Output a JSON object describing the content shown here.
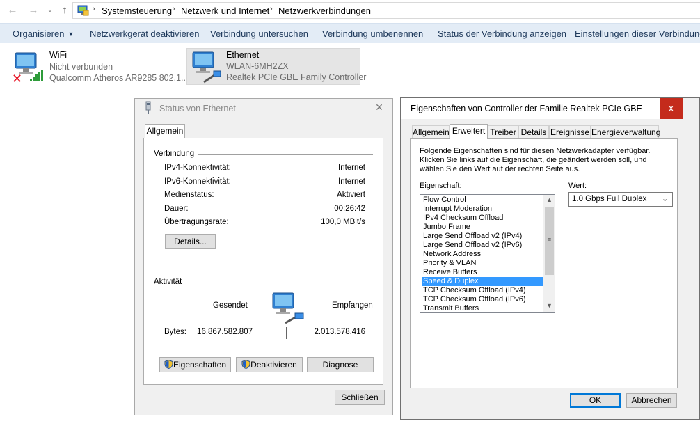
{
  "address": {
    "crumbs": [
      "Systemsteuerung",
      "Netzwerk und Internet",
      "Netzwerkverbindungen"
    ]
  },
  "commands": {
    "organize": "Organisieren",
    "disable_device": "Netzwerkgerät deaktivieren",
    "diagnose": "Verbindung untersuchen",
    "rename": "Verbindung umbenennen",
    "show_status": "Status der Verbindung anzeigen",
    "change_settings": "Einstellungen dieser Verbindung ä"
  },
  "adapters": [
    {
      "name": "WiFi",
      "status": "Nicht verbunden",
      "device": "Qualcomm Atheros AR9285 802.1..."
    },
    {
      "name": "Ethernet",
      "status": "WLAN-6MH2ZX",
      "device": "Realtek PCIe GBE Family Controller"
    }
  ],
  "status_dialog": {
    "title": "Status von Ethernet",
    "tab": "Allgemein",
    "connection_group": "Verbindung",
    "rows": [
      {
        "label": "IPv4-Konnektivität:",
        "value": "Internet"
      },
      {
        "label": "IPv6-Konnektivität:",
        "value": "Internet"
      },
      {
        "label": "Medienstatus:",
        "value": "Aktiviert"
      },
      {
        "label": "Dauer:",
        "value": "00:26:42"
      },
      {
        "label": "Übertragungsrate:",
        "value": "100,0 MBit/s"
      }
    ],
    "details_button": "Details...",
    "activity_group": "Aktivität",
    "sent_label": "Gesendet",
    "received_label": "Empfangen",
    "bytes_label": "Bytes:",
    "bytes_sent": "16.867.582.807",
    "bytes_received": "2.013.578.416",
    "properties_button": "Eigenschaften",
    "disable_button": "Deaktivieren",
    "diagnose_button": "Diagnose",
    "close_button": "Schließen"
  },
  "properties_dialog": {
    "title": "Eigenschaften von Controller der Familie Realtek PCIe GBE",
    "tabs": [
      "Allgemein",
      "Erweitert",
      "Treiber",
      "Details",
      "Ereignisse",
      "Energieverwaltung"
    ],
    "active_tab": "Erweitert",
    "description": [
      "Folgende Eigenschaften sind für diesen Netzwerkadapter verfügbar.",
      "Klicken Sie links auf die Eigenschaft, die geändert werden soll, und",
      "wählen Sie den Wert auf der rechten Seite aus."
    ],
    "property_label": "Eigenschaft:",
    "value_label": "Wert:",
    "properties": [
      "Flow Control",
      "Interrupt Moderation",
      "IPv4 Checksum Offload",
      "Jumbo Frame",
      "Large Send Offload v2 (IPv4)",
      "Large Send Offload v2 (IPv6)",
      "Network Address",
      "Priority & VLAN",
      "Receive Buffers",
      "Speed & Duplex",
      "TCP Checksum Offload (IPv4)",
      "TCP Checksum Offload (IPv6)",
      "Transmit Buffers"
    ],
    "selected_property": "Speed & Duplex",
    "value": "1.0 Gbps Full Duplex",
    "ok_button": "OK",
    "cancel_button": "Abbrechen",
    "close_glyph": "x"
  },
  "colors": {
    "command_bar": "#e3ecf6",
    "command_text": "#1e395b",
    "selection": "#3399ff",
    "close_red": "#c42b1c"
  }
}
